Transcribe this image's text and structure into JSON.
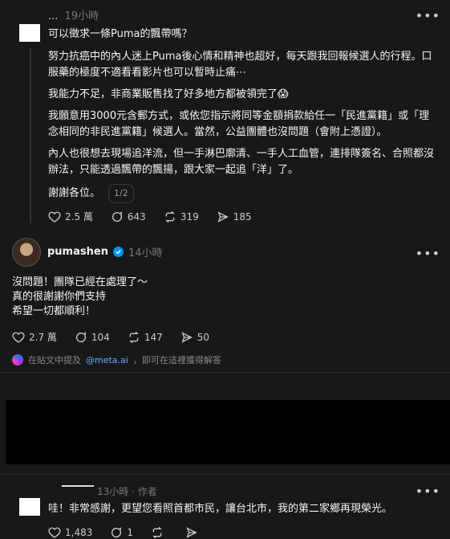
{
  "post1": {
    "username_partial": "...",
    "time": "19小時",
    "title": "可以徵求一條Puma的飄帶嗎？",
    "paragraphs": [
      "努力抗癌中的內人迷上Puma後心情和精神也超好，每天跟我回報候選人的行程。口服藥的極度不適看看影片也可以暫時止痛⋯",
      "我能力不足，非商業販售找了好多地方都被領完了😱",
      "我願意用3000元含郵方式，或依您指示將同等金額捐款給任一「民進黨籍」或「理念相同的非民進黨籍」候選人。當然，公益團體也沒問題（會附上憑證）。",
      "內人也很想去現場追洋流，但一手淋巴廓清、一手人工血管，連排隊簽名、合照都沒辦法，只能透過飄帶的飄揚，跟大家一起追「洋」了。",
      "謝謝各位。"
    ],
    "page_indicator": "1/2",
    "stats": {
      "likes": "2.5 萬",
      "comments": "643",
      "reposts": "319",
      "shares": "185"
    }
  },
  "post2": {
    "username": "pumashen",
    "time": "14小時",
    "lines": [
      "沒問題！團隊已經在處理了～",
      "真的很謝謝你們支持",
      "希望一切都順利！"
    ],
    "stats": {
      "likes": "2.7 萬",
      "comments": "104",
      "reposts": "147",
      "shares": "50"
    },
    "meta_hint_prefix": "在貼文中提及",
    "meta_link": "@meta.ai",
    "meta_hint_suffix": "，即可在這裡獲得解答"
  },
  "post3": {
    "time": "13小時 · 作者",
    "text": "哇！非常感謝，更望您看照首都市民，讓台北市，我的第二家鄉再現榮光。",
    "stats": {
      "likes": "1,483",
      "comments": "1"
    }
  },
  "icons": {
    "more": "more-horizontal-icon",
    "like": "heart-icon",
    "comment": "comment-icon",
    "repost": "repost-icon",
    "share": "send-icon"
  }
}
